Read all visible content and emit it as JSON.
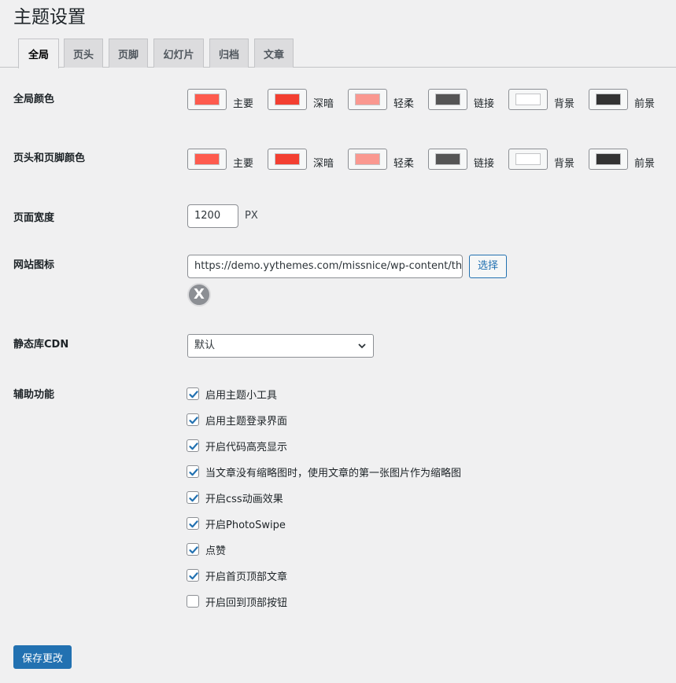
{
  "page": {
    "title": "主题设置"
  },
  "tabs": [
    {
      "label": "全局",
      "active": true
    },
    {
      "label": "页头",
      "active": false
    },
    {
      "label": "页脚",
      "active": false
    },
    {
      "label": "幻灯片",
      "active": false
    },
    {
      "label": "归档",
      "active": false
    },
    {
      "label": "文章",
      "active": false
    }
  ],
  "global_colors": {
    "label": "全局颜色",
    "swatches": [
      {
        "label": "主要",
        "color": "#fe5b4e"
      },
      {
        "label": "深暗",
        "color": "#f33f31"
      },
      {
        "label": "轻柔",
        "color": "#fa9890"
      },
      {
        "label": "链接",
        "color": "#555555"
      },
      {
        "label": "背景",
        "color": "#ffffff"
      },
      {
        "label": "前景",
        "color": "#333333"
      }
    ]
  },
  "header_footer_colors": {
    "label": "页头和页脚颜色",
    "swatches": [
      {
        "label": "主要",
        "color": "#fe5b4e"
      },
      {
        "label": "深暗",
        "color": "#f33f31"
      },
      {
        "label": "轻柔",
        "color": "#fa9890"
      },
      {
        "label": "链接",
        "color": "#555555"
      },
      {
        "label": "背景",
        "color": "#ffffff"
      },
      {
        "label": "前景",
        "color": "#333333"
      }
    ]
  },
  "page_width": {
    "label": "页面宽度",
    "value": "1200",
    "unit": "PX"
  },
  "site_icon": {
    "label": "网站图标",
    "value": "https://demo.yythemes.com/missnice/wp-content/the",
    "select_label": "选择",
    "remove_glyph": "X"
  },
  "cdn": {
    "label": "静态库CDN",
    "selected": "默认"
  },
  "features": {
    "label": "辅助功能",
    "items": [
      {
        "label": "启用主题小工具",
        "checked": true
      },
      {
        "label": "启用主题登录界面",
        "checked": true
      },
      {
        "label": "开启代码高亮显示",
        "checked": true
      },
      {
        "label": "当文章没有缩略图时，使用文章的第一张图片作为缩略图",
        "checked": true
      },
      {
        "label": "开启css动画效果",
        "checked": true
      },
      {
        "label": "开启PhotoSwipe",
        "checked": true
      },
      {
        "label": "点赞",
        "checked": true
      },
      {
        "label": "开启首页顶部文章",
        "checked": true
      },
      {
        "label": "开启回到顶部按钮",
        "checked": false
      }
    ]
  },
  "save_button": {
    "label": "保存更改"
  }
}
